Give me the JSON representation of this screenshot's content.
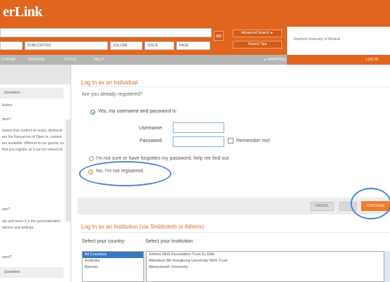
{
  "header": {
    "logo_text": "erLink",
    "search_value": "",
    "go_label": "GO",
    "fields": {
      "author": "",
      "publication": "PUBLICATION",
      "volume": "VOLUME",
      "issue": "ISSUE",
      "page": "PAGE"
    },
    "advanced_search_label": "Advanced Search ►",
    "search_tips_label": "Search Tips",
    "institution_name": "Stanford University of Medical"
  },
  "navbar": {
    "items": [
      "FORUM",
      "BROWSE",
      "TOOLS",
      "HELP"
    ],
    "cart_label": "◄ SHOPPING CART",
    "right_label": "LOG IN"
  },
  "sidebar": {
    "section_1_title": "Questions",
    "subhead_1": "Author",
    "question_1": "dent?",
    "paragraph_1": "leaves that content on ready, abstracts are the Resources of Open ts, content are available. different to our guests. es that you register as it can be viewed at",
    "question_2": "ster?",
    "paragraph_2": "ate and never it is the personalization service and settings.",
    "question_3": "word?",
    "section_2_title": "Questions"
  },
  "login": {
    "title": "Log In as an Individual",
    "registered_question": "Are you already registered?",
    "option_yes": "Yes, my username and password is:",
    "username_label": "Username:",
    "username_value": "",
    "password_label": "Password:",
    "password_value": "",
    "remember_label": "Remember me!",
    "option_forgot": "I'm not sure or have forgotten my password, help me find out.",
    "option_no": "No, I'm not registered.",
    "cancel_label": "CANCEL",
    "continue_label": "CONTINUE"
  },
  "institution": {
    "title": "Log In as an Institution (via Shibboleth or Athens)",
    "country_label": "Select your country:",
    "institution_label": "Select your Institution:",
    "countries": [
      "All Countries",
      "Australia",
      "Bahrain"
    ],
    "institutions": [
      "Aintree NHS Foundation Trust Sc Ellie",
      "Aberdeen Bir Hongkong University NHS Trust",
      "Aberystwyth University"
    ]
  },
  "colors": {
    "brand_orange": "#e0661f",
    "annotation_blue": "#4b86d6",
    "title_orange": "#d86d2a"
  }
}
